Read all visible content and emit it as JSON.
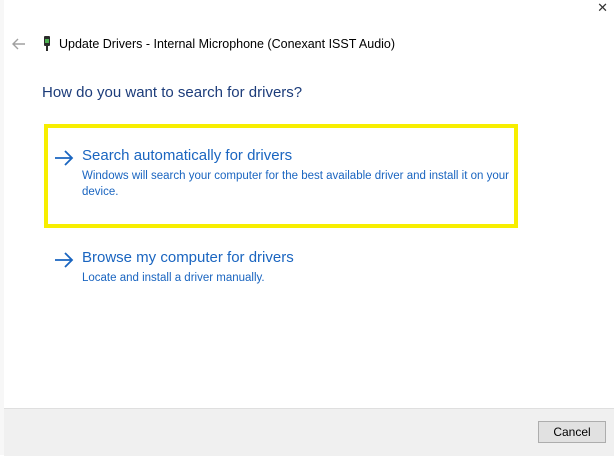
{
  "window": {
    "title": "Update Drivers - Internal Microphone (Conexant ISST Audio)"
  },
  "question": "How do you want to search for drivers?",
  "options": [
    {
      "title": "Search automatically for drivers",
      "description": "Windows will search your computer for the best available driver and install it on your device.",
      "highlighted": true
    },
    {
      "title": "Browse my computer for drivers",
      "description": "Locate and install a driver manually.",
      "highlighted": false
    }
  ],
  "footer": {
    "cancel_label": "Cancel"
  },
  "colors": {
    "link_blue": "#1a65c0",
    "heading_blue": "#1c3c7a",
    "highlight_yellow": "#f7ee00"
  }
}
